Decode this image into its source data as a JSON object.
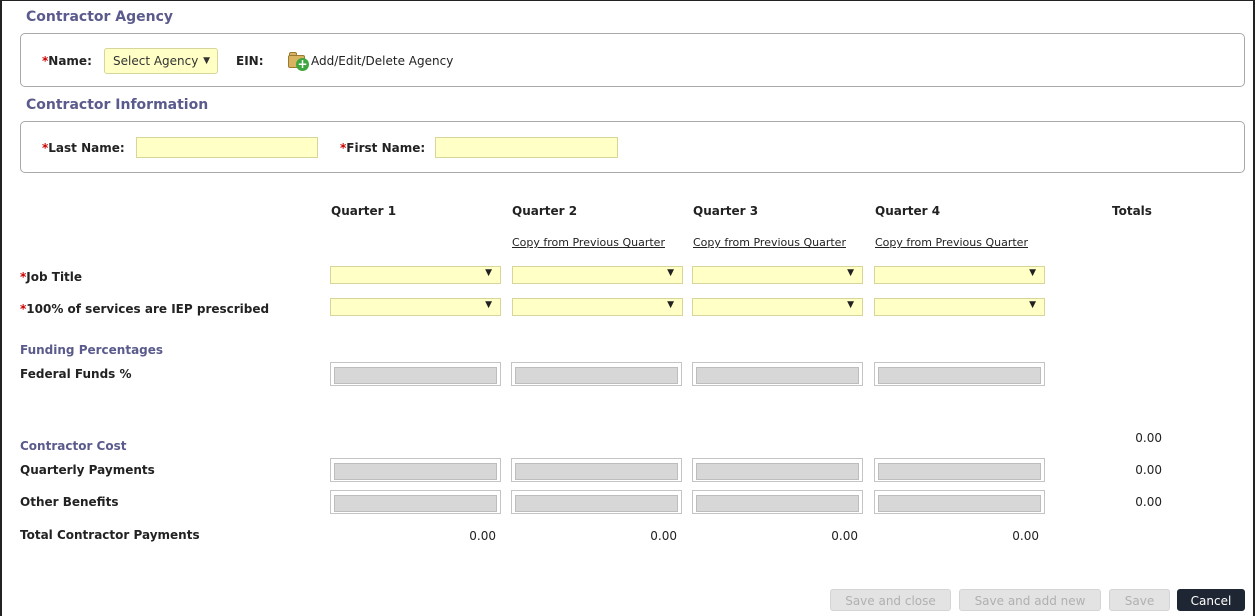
{
  "agency": {
    "section_title": "Contractor Agency",
    "name_label": "Name:",
    "name_select_value": "Select Agency",
    "ein_label": "EIN:",
    "add_edit_link": "Add/Edit/Delete Agency"
  },
  "contractor_info": {
    "section_title": "Contractor Information",
    "last_name_label": "Last Name:",
    "last_name_value": "",
    "first_name_label": "First Name:",
    "first_name_value": ""
  },
  "required_marker": "*",
  "quarters": {
    "headers": [
      "Quarter 1",
      "Quarter 2",
      "Quarter 3",
      "Quarter 4"
    ],
    "totals_header": "Totals",
    "copy_link": "Copy from Previous Quarter"
  },
  "rows": {
    "job_title_label": "Job Title",
    "iep_label": "100% of services are IEP prescribed",
    "funding_heading": "Funding Percentages",
    "federal_funds_label": "Federal Funds %",
    "contractor_cost_heading": "Contractor Cost",
    "quarterly_payments_label": "Quarterly Payments",
    "other_benefits_label": "Other Benefits",
    "total_payments_label": "Total Contractor Payments"
  },
  "totals": {
    "contractor_cost_total": "0.00",
    "quarterly_payments_total": "0.00",
    "other_benefits_total": "0.00",
    "total_payments": [
      "0.00",
      "0.00",
      "0.00",
      "0.00"
    ]
  },
  "buttons": {
    "save_and_close": "Save and close",
    "save_and_add_new": "Save and add new",
    "save": "Save",
    "cancel": "Cancel"
  },
  "colors": {
    "required_field_bg": "#ffffc6",
    "section_title": "#5a5a8c",
    "required_marker": "#cc0000",
    "primary_button": "#1f2633"
  }
}
